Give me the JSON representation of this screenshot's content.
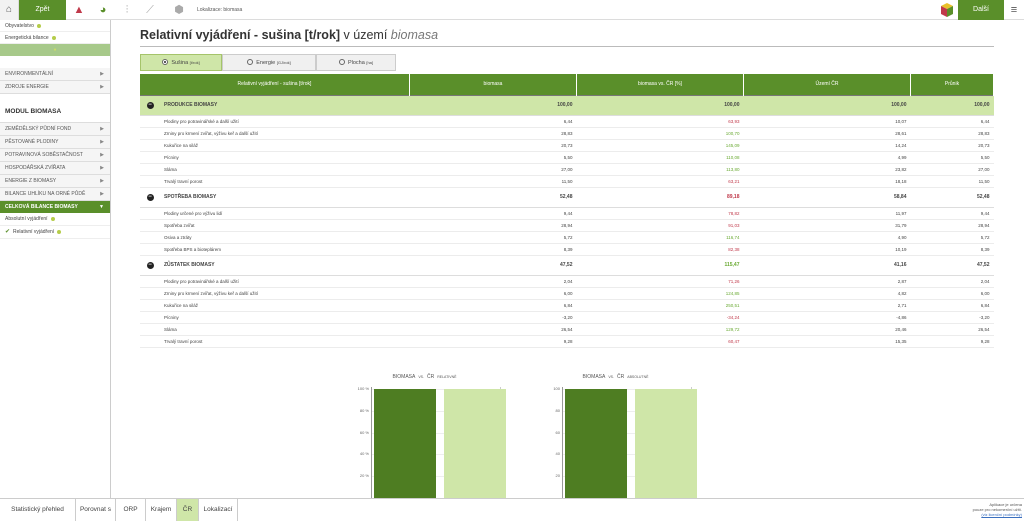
{
  "topbar": {
    "back": "Zpět",
    "location": "Lokalizace: biomasa",
    "next": "Další"
  },
  "sidebar": {
    "top_items": [
      "Obyvatelstvo",
      "Energetická bilance"
    ],
    "sections": [
      "ENVIRONMENTÁLNÍ",
      "ZDROJE ENERGIE"
    ],
    "module": "MODUL BIOMASA",
    "items": [
      "ZEMĚDĚLSKÝ PŮDNÍ FOND",
      "PĚSTOVANÉ PLODINY",
      "POTRAVINOVÁ SOBĚSTAČNOST",
      "HOSPODÁŘSKÁ ZVÍŘATA",
      "ENERGIE Z BIOMASY",
      "BILANCE UHLÍKU NA ORNÉ PŮDĚ"
    ],
    "active": "CELKOVÁ BILANCE BIOMASY",
    "subitems": [
      "Absolutní vyjádření",
      "Relativní vyjádření"
    ]
  },
  "main": {
    "title_bold": "Relativní vyjádření - sušina [t/rok]",
    "title_rest": "v území",
    "title_italic": "biomasa",
    "tabs": [
      {
        "label": "Sušina",
        "unit": "[t/rok]"
      },
      {
        "label": "Energie",
        "unit": "[GJ/rok]"
      },
      {
        "label": "Plocha",
        "unit": "[ha]"
      }
    ],
    "table": {
      "headers": [
        "Relativní vyjádření - sušina [t/rok]",
        "biomasa",
        "biomasa vs. ČR [%]",
        "Území ČR",
        "Průnik"
      ],
      "groups": [
        {
          "name": "PRODUKCE BIOMASY",
          "values": [
            "100,00",
            "100,00",
            "100,00",
            "100,00"
          ],
          "rows": [
            [
              "Plodiny pro potravinářské a další užití",
              "6,44",
              "63,93",
              "10,07",
              "6,44"
            ],
            [
              "Zrniny pro krmení zvířat, výživu keř a další užití",
              "28,83",
              "100,70",
              "28,61",
              "28,83"
            ],
            [
              "Kukuřice na siláž",
              "20,73",
              "145,09",
              "14,24",
              "20,73"
            ],
            [
              "Pícniny",
              "5,50",
              "110,08",
              "4,99",
              "5,50"
            ],
            [
              "Sláma",
              "27,00",
              "113,80",
              "23,82",
              "27,00"
            ],
            [
              "Trvalý travní porost",
              "11,50",
              "63,21",
              "18,18",
              "11,50"
            ]
          ]
        },
        {
          "name": "SPOTŘEBA BIOMASY",
          "values": [
            "52,48",
            "89,18",
            "58,84",
            "52,48"
          ],
          "rows": [
            [
              "Plodiny určené pro výživu lidí",
              "9,44",
              "78,82",
              "11,97",
              "9,44"
            ],
            [
              "Spotřeba zvířat",
              "28,94",
              "91,03",
              "31,79",
              "28,94"
            ],
            [
              "Osiva a ztráty",
              "5,72",
              "116,74",
              "4,90",
              "5,72"
            ],
            [
              "Spotřeba BPS a bioteplárem",
              "8,39",
              "82,38",
              "10,19",
              "8,39"
            ]
          ]
        },
        {
          "name": "ZŮSTATEK BIOMASY",
          "values": [
            "47,52",
            "115,47",
            "41,16",
            "47,52"
          ],
          "rows": [
            [
              "Plodiny pro potravinářské a další užití",
              "2,04",
              "71,26",
              "2,87",
              "2,04"
            ],
            [
              "Zrniny pro krmení zvířat, výživu keř a další užití",
              "6,00",
              "124,85",
              "4,82",
              "6,00"
            ],
            [
              "Kukuřice na siláž",
              "6,84",
              "250,51",
              "2,71",
              "6,84"
            ],
            [
              "Pícniny",
              "-3,20",
              "-34,24",
              "-4,86",
              "-3,20"
            ],
            [
              "Sláma",
              "26,54",
              "129,72",
              "20,46",
              "26,54"
            ],
            [
              "Trvalý travní porost",
              "9,28",
              "60,47",
              "15,35",
              "9,28"
            ]
          ]
        }
      ]
    },
    "colors": {
      "accent": "#5a8f2a",
      "light": "#cfe6a8",
      "red": "#c0394a",
      "green": "#6aaa33"
    }
  },
  "chart_data": [
    {
      "type": "bar",
      "title_a": "BIOMASA",
      "title_vs": "VS.",
      "title_b": "ČR",
      "title_c": "RELATIVNĚ",
      "ticks": [
        "100 %",
        "80 %",
        "60 %",
        "40 %",
        "20 %"
      ],
      "ylim": [
        0,
        100
      ],
      "values": [
        100,
        100
      ]
    },
    {
      "type": "bar",
      "title_a": "BIOMASA",
      "title_vs": "VS.",
      "title_b": "ČR",
      "title_c": "ABSOLUTNĚ",
      "ticks": [
        "100",
        "80",
        "60",
        "40",
        "20"
      ],
      "ylim": [
        0,
        100
      ],
      "values": [
        100,
        100
      ]
    }
  ],
  "statusbar": {
    "overview": "Statistický přehled",
    "compare": "Porovnat s",
    "orp": "ORP",
    "kraj": "Krajem",
    "cr": "ČR",
    "loc": "Lokalizací",
    "legal1": "Aplikace je určena",
    "legal2": "pouze pro nekomerční užití.",
    "legal3": "(viz licenční podmínky)"
  }
}
